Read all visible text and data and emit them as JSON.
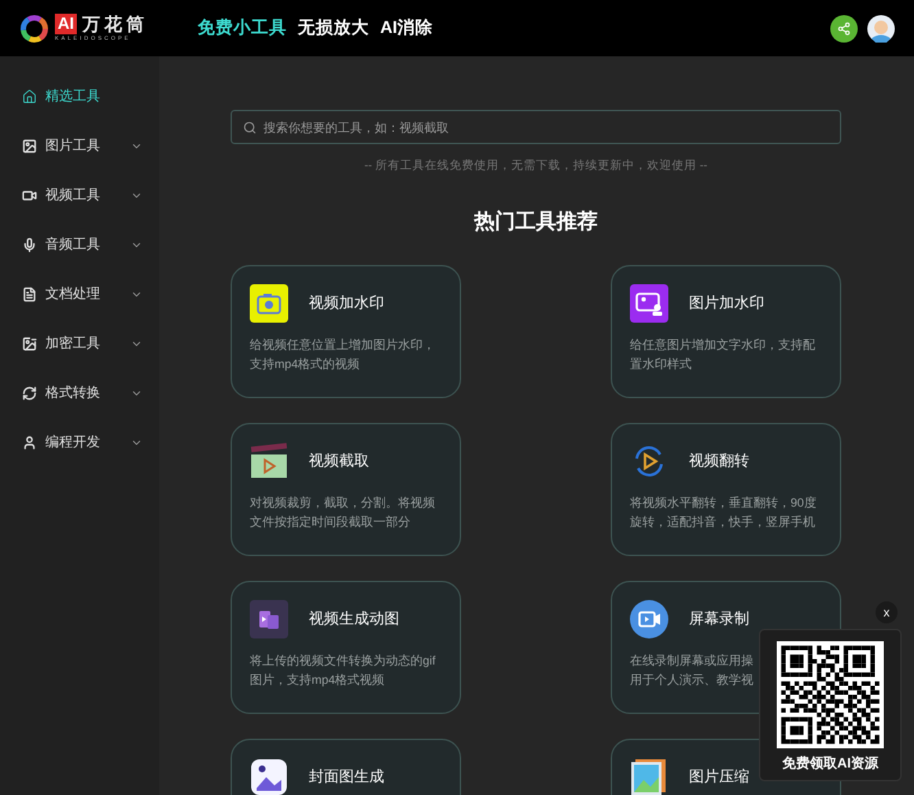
{
  "header": {
    "logo": {
      "badge": "AI",
      "name": "万花筒",
      "tagline": "KALEIDOSCOPE"
    },
    "nav": [
      {
        "label": "免费小工具",
        "selected": true
      },
      {
        "label": "无损放大",
        "selected": false
      },
      {
        "label": "AI消除",
        "selected": false
      }
    ]
  },
  "sidebar": {
    "items": [
      {
        "label": "精选工具",
        "selected": true,
        "has_submenu": false
      },
      {
        "label": "图片工具",
        "selected": false,
        "has_submenu": true
      },
      {
        "label": "视频工具",
        "selected": false,
        "has_submenu": true
      },
      {
        "label": "音频工具",
        "selected": false,
        "has_submenu": true
      },
      {
        "label": "文档处理",
        "selected": false,
        "has_submenu": true
      },
      {
        "label": "加密工具",
        "selected": false,
        "has_submenu": true
      },
      {
        "label": "格式转换",
        "selected": false,
        "has_submenu": true
      },
      {
        "label": "编程开发",
        "selected": false,
        "has_submenu": true
      }
    ]
  },
  "search": {
    "placeholder": "搜索你想要的工具，如：视频截取"
  },
  "notice": "-- 所有工具在线免费使用，无需下载，持续更新中，欢迎使用 --",
  "section_title": "热门工具推荐",
  "tools": [
    {
      "title": "视频加水印",
      "lines": [
        "给视频任意位置上增加图片水印，",
        "支持mp4格式的视频"
      ]
    },
    {
      "title": "图片加水印",
      "lines": [
        "给任意图片增加文字水印，支持配",
        "置水印样式"
      ]
    },
    {
      "title": "视频截取",
      "lines": [
        "对视频裁剪，截取，分割。将视频",
        "文件按指定时间段截取一部分"
      ]
    },
    {
      "title": "视频翻转",
      "lines": [
        "将视频水平翻转，垂直翻转，90度",
        "旋转，适配抖音，快手，竖屏手机"
      ]
    },
    {
      "title": "视频生成动图",
      "lines": [
        "将上传的视频文件转换为动态的gif",
        "图片，支持mp4格式视频"
      ]
    },
    {
      "title": "屏幕录制",
      "lines": [
        "在线录制屏幕或应用操",
        "用于个人演示、教学视"
      ]
    },
    {
      "title": "封面图生成"
    },
    {
      "title": "图片压缩"
    }
  ],
  "popup": {
    "close": "x",
    "caption": "免费领取AI资源"
  }
}
